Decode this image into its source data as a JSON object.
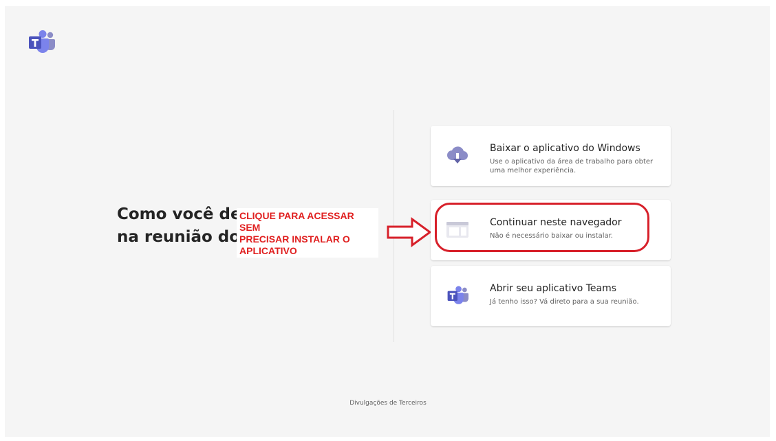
{
  "main": {
    "heading_line1": "Como você de",
    "heading_line2": "na reunião do"
  },
  "annotation": {
    "line1": "CLIQUE PARA ACESSAR SEM",
    "line2": "PRECISAR INSTALAR O",
    "line3": "APLICATIVO",
    "color": "#e02020"
  },
  "options": [
    {
      "icon": "download-cloud-icon",
      "title": "Baixar o aplicativo do Windows",
      "description": "Use o aplicativo da área de trabalho para obter uma melhor experiência."
    },
    {
      "icon": "browser-window-icon",
      "title": "Continuar neste navegador",
      "description": "Não é necessário baixar ou instalar."
    },
    {
      "icon": "teams-logo-icon",
      "title": "Abrir seu aplicativo Teams",
      "description": "Já tenho isso? Vá direto para a sua reunião."
    }
  ],
  "footer": {
    "link": "Divulgações de Terceiros"
  },
  "colors": {
    "brand": "#6264a7",
    "brand_light": "#8b8cc7",
    "highlight": "#d7202a"
  }
}
